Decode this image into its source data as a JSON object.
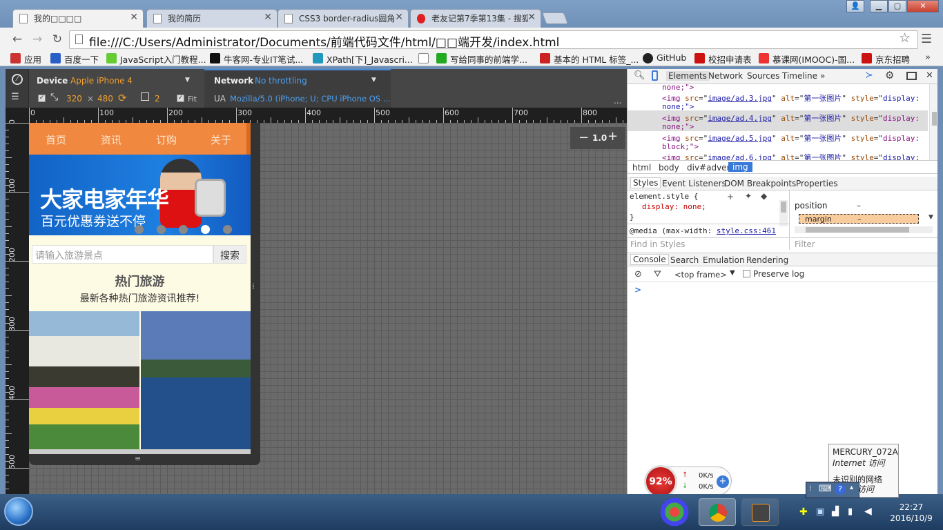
{
  "tabs": [
    {
      "label": "我的□□□□",
      "active": true
    },
    {
      "label": "我的简历",
      "active": false
    },
    {
      "label": "CSS3 border-radius圆角",
      "active": false
    },
    {
      "label": "老友记第7季第13集 - 搜狐",
      "active": false
    }
  ],
  "address": "file:///C:/Users/Administrator/Documents/前端代码文件/html/□□端开发/index.html",
  "bookmarks": [
    {
      "label": "应用",
      "color": "#c33"
    },
    {
      "label": "百度一下",
      "color": "#2a5fc8"
    },
    {
      "label": "JavaScript入门教程...",
      "color": "#6c3"
    },
    {
      "label": "牛客网-专业IT笔试...",
      "color": "#111"
    },
    {
      "label": "XPath[下]_Javascri...",
      "color": "#29b"
    },
    {
      "label": "",
      "color": "#ddd"
    },
    {
      "label": "写给同事的前端学...",
      "color": "#2a2"
    },
    {
      "label": "基本的 HTML 标签_...",
      "color": "#c22"
    },
    {
      "label": "GitHub",
      "color": "#222"
    },
    {
      "label": "校招申请表",
      "color": "#c11"
    },
    {
      "label": "慕课网(IMOOC)-国...",
      "color": "#e33"
    },
    {
      "label": "京东招聘",
      "color": "#c11"
    }
  ],
  "bookmarks_more": "»",
  "device": {
    "device_label": "Device",
    "device_value": "Apple iPhone 4",
    "width": "320",
    "times": "×",
    "height": "480",
    "dpr": "2",
    "fit": "Fit",
    "network_label": "Network",
    "network_value": "No throttling",
    "ua_label": "UA",
    "ua_value": "Mozilla/5.0 (iPhone; U; CPU iPhone OS ...",
    "zoom": "1.0",
    "more": "...",
    "hruler": [
      "0",
      "100",
      "200",
      "300",
      "400",
      "500",
      "600",
      "700",
      "800"
    ],
    "vruler": [
      "0",
      "100",
      "200",
      "300",
      "400",
      "500"
    ]
  },
  "phone": {
    "nav": [
      "首页",
      "资讯",
      "订购",
      "关于"
    ],
    "banner_title": "大家电家年华",
    "banner_sub": "百元优惠券送不停",
    "search_placeholder": "请输入旅游景点",
    "search_button": "搜索",
    "hot_title": "热门旅游",
    "hot_sub": "最新各种热门旅游资讯推荐!"
  },
  "devtools": {
    "tabs": [
      "Elements",
      "Network",
      "Sources",
      "Timeline",
      "»"
    ],
    "code": [
      {
        "pre": "none;\">",
        "src": "",
        "alt": "",
        "style": ""
      },
      {
        "pre": "<img ",
        "src": "image/ad.3.jpg",
        "alt": "第一张图片",
        "style": "display:"
      },
      {
        "pre": "none;\">",
        "src": "",
        "alt": "",
        "style": ""
      },
      {
        "pre": "<img ",
        "src": "image/ad.4.jpg",
        "alt": "第一张图片",
        "style": "display:"
      },
      {
        "pre": "none;\">",
        "src": "",
        "alt": "",
        "style": ""
      },
      {
        "pre": "<img ",
        "src": "image/ad.5.jpg",
        "alt": "第一张图片",
        "style": "display:"
      },
      {
        "pre": "block;\">",
        "src": "",
        "alt": "",
        "style": ""
      },
      {
        "pre": "<img ",
        "src": "image/ad.6.jpg",
        "alt": "第一张图片",
        "style": "display:"
      }
    ],
    "crumbs": [
      "html",
      "body",
      "div#adver",
      "img"
    ],
    "style_tabs": [
      "Styles",
      "Event Listeners",
      "DOM Breakpoints",
      "Properties"
    ],
    "element_style": "element.style {",
    "display_rule": "display: none;",
    "close_brace": "}",
    "media_rule": "@media (max-width:",
    "media_link": "style.css:461",
    "find_styles": "Find in Styles",
    "position_label": "position",
    "position_val": "–",
    "margin_label": "margin",
    "margin_val": "–",
    "filter": "Filter",
    "console_tabs": [
      "Console",
      "Search",
      "Emulation",
      "Rendering"
    ],
    "frame": "<top frame>",
    "preserve_log": "Preserve log",
    "prompt": ">"
  },
  "net_popup": {
    "name": "MERCURY_072A",
    "status": "Internet 访问",
    "line3": "未识别的网络",
    "line4": "无网络访问"
  },
  "speed": {
    "pct": "92%",
    "up": "0K/s",
    "down": "0K/s"
  },
  "clock": {
    "time": "22:27",
    "date": "2016/10/9"
  }
}
